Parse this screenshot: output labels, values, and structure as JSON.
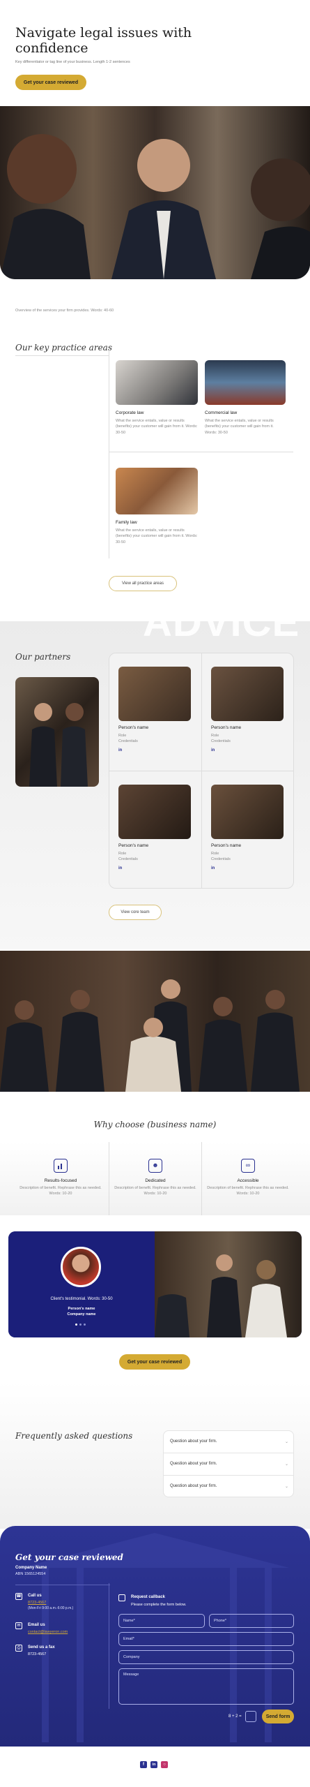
{
  "hero": {
    "title": "Navigate legal issues with confidence",
    "subtitle": "Key differentiator or tag line of your business. Length 1-2 sentences",
    "cta": "Get your case reviewed"
  },
  "practice": {
    "overview": "Overview of the services your firm provides. Words: 40-60",
    "heading": "Our key practice areas",
    "cards": [
      {
        "title": "Corporate law",
        "desc": "What the service entails, value or results (benefits) your customer will gain from it. Words: 30-50"
      },
      {
        "title": "Commercial law",
        "desc": "What the service entails, value or results (benefits) your customer will gain from it. Words: 30-50"
      },
      {
        "title": "Family law",
        "desc": "What the service entails, value or results (benefits) your customer will gain from it. Words: 30-50"
      }
    ],
    "view_all": "View all practice areas"
  },
  "partners": {
    "watermark": "ADVICE",
    "heading": "Our partners",
    "people": [
      {
        "name": "Person's name",
        "role": "Role",
        "credentials": "Credentials"
      },
      {
        "name": "Person's name",
        "role": "Role",
        "credentials": "Credentials"
      },
      {
        "name": "Person's name",
        "role": "Role",
        "credentials": "Credentials"
      },
      {
        "name": "Person's name",
        "role": "Role",
        "credentials": "Credentials"
      }
    ],
    "view_team": "View core team"
  },
  "why": {
    "heading": "Why choose (business name)",
    "items": [
      {
        "title": "Results-focused",
        "desc": "Description of benefit. Rephrase this as needed. Words: 10-20",
        "icon": "chart-icon"
      },
      {
        "title": "Dedicated",
        "desc": "Description of benefit. Rephrase this as needed. Words: 10-20",
        "icon": "people-icon"
      },
      {
        "title": "Accessible",
        "desc": "Description of benefit. Rephrase this as needed. Words: 10-20",
        "icon": "network-icon"
      }
    ]
  },
  "testimonial": {
    "quote": "Client's testimonial. Words: 30-50",
    "name": "Person's name",
    "company": "Company name",
    "cta": "Get your case reviewed"
  },
  "faq": {
    "heading": "Frequently asked questions",
    "items": [
      "Question about your firm.",
      "Question about your firm.",
      "Question about your firm."
    ]
  },
  "contact": {
    "heading": "Get your case reviewed",
    "company": "Company Name",
    "abn": "ABN 1565124554",
    "call_label": "Call us",
    "call_number": "8723-4567",
    "call_hours": "(Mon-Fri 9:00 a.m.-6:00 p.m.)",
    "email_label": "Email us",
    "email": "contact@lawyeron.com",
    "fax_label": "Send us a fax",
    "fax": "8723-4567",
    "form_title": "Request callback",
    "form_sub": "Please complete the form below.",
    "name_ph": "Name*",
    "phone_ph": "Phone*",
    "email_ph": "Email*",
    "company_ph": "Company",
    "message_ph": "Message",
    "captcha": "8 + 2 =",
    "send": "Send form"
  },
  "colors": {
    "gold": "#d4aa33",
    "navy": "#2a3190"
  }
}
